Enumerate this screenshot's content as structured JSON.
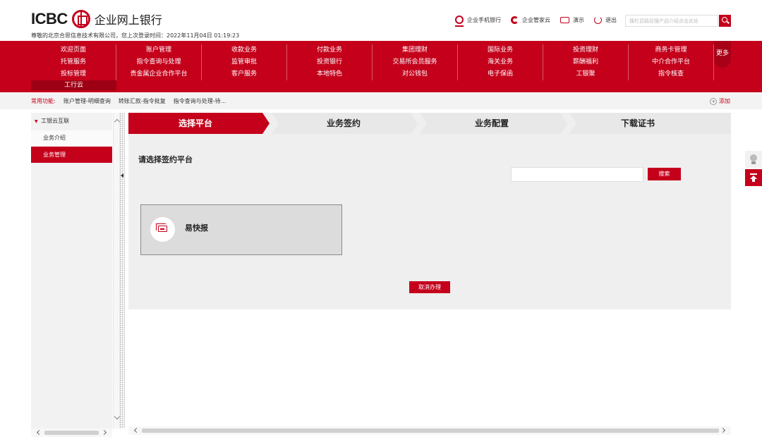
{
  "header": {
    "logo_text": "ICBC",
    "logo_cn": "企业网上银行",
    "welcome": "尊敬的北京合思信息技术有限公司，您上次登录时间：2022年11月04日 01:19:23",
    "tools": [
      "企业手机银行",
      "企业管家云",
      "演示",
      "退出"
    ],
    "search_placeholder": "搜栏目路径搜产品介绍点击此处"
  },
  "menu": {
    "columns": [
      [
        "欢迎页面",
        "托管服务",
        "投标管理"
      ],
      [
        "账户管理",
        "指令查询与处理",
        "贵金属企业合作平台"
      ],
      [
        "收款业务",
        "监管审批",
        "客户服务"
      ],
      [
        "付款业务",
        "投资银行",
        "本地特色"
      ],
      [
        "集团理财",
        "交易所会员服务",
        "对公钱包"
      ],
      [
        "国际业务",
        "海关业务",
        "电子保函"
      ],
      [
        "投资理财",
        "薪酬福利",
        "工银聚"
      ],
      [
        "商务卡管理",
        "中介合作平台",
        "指令核查"
      ]
    ],
    "extra": "工行云",
    "more": "更多"
  },
  "common": {
    "label": "常用功能:",
    "links": [
      "账户管理-明细查询",
      "转账汇款-指令批复",
      "指令查询与处理-待..."
    ],
    "add": "添加"
  },
  "sidebar": {
    "group": "工银云互联",
    "items": [
      "业务介绍",
      "业务管理"
    ]
  },
  "steps": [
    "选择平台",
    "业务签约",
    "业务配置",
    "下载证书"
  ],
  "main": {
    "title": "请选择签约平台",
    "search_btn": "搜索",
    "platform_name": "易快报",
    "cancel_btn": "取消办理"
  },
  "colors": {
    "brand_red": "#c4001b",
    "step_active": "#c4001b",
    "step_inactive": "#e8e8e8"
  }
}
